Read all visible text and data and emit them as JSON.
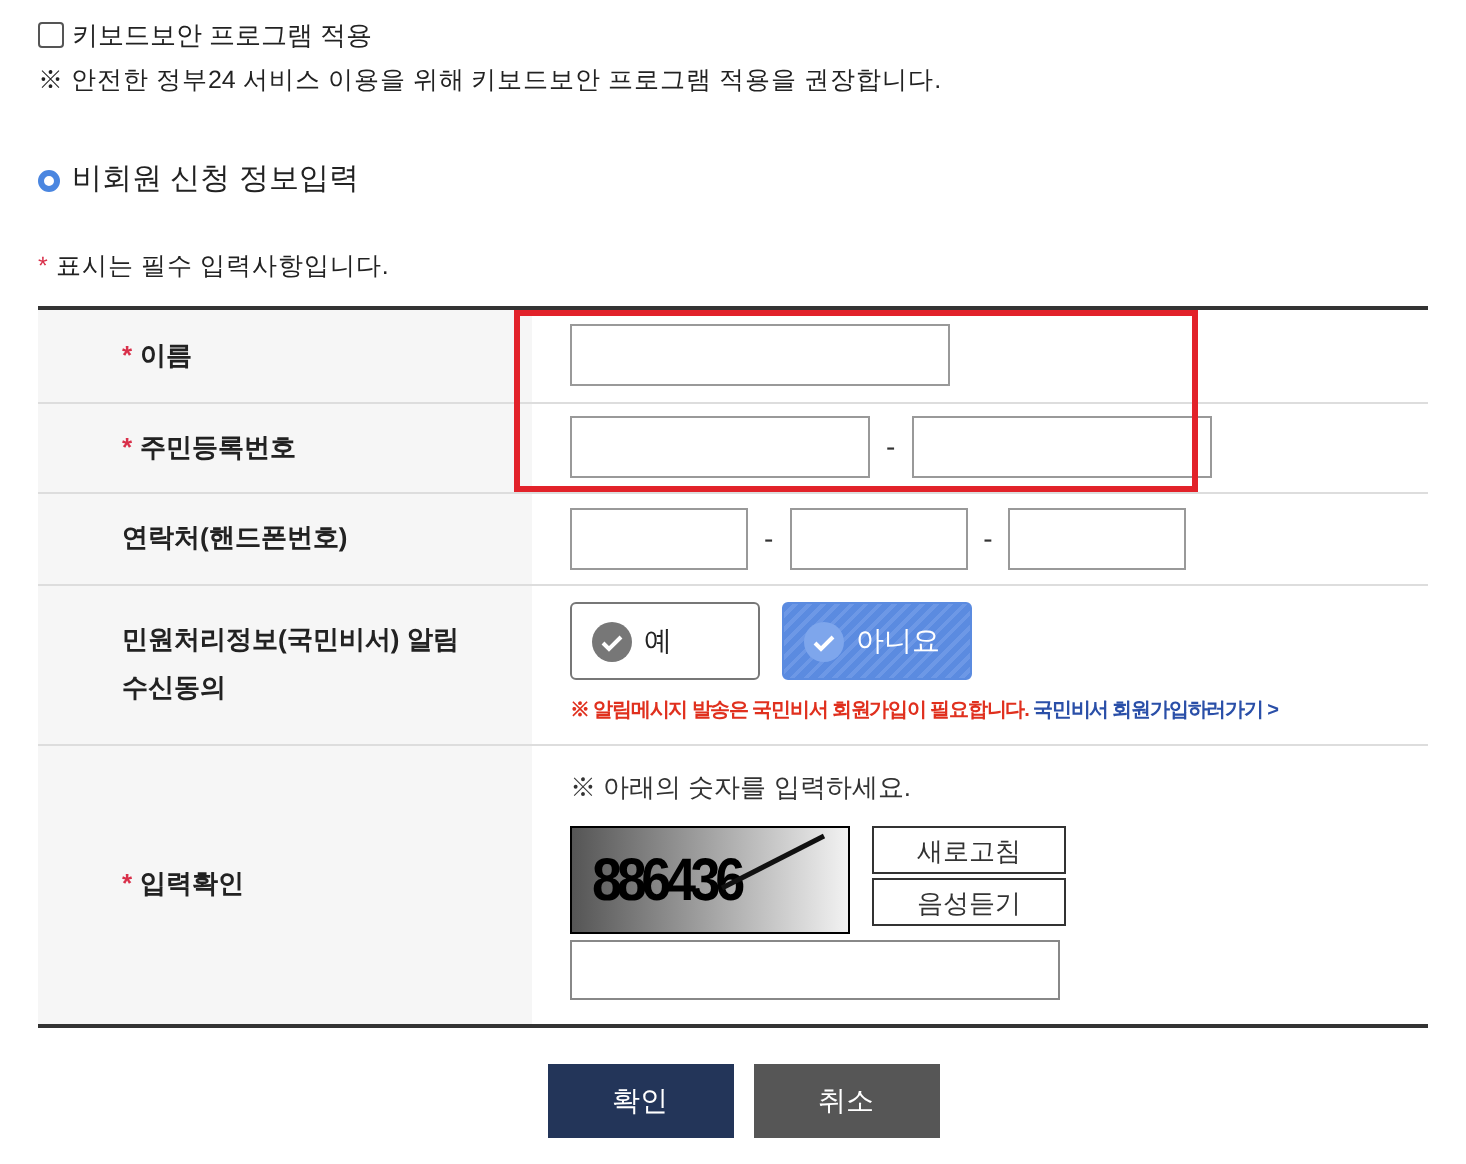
{
  "security": {
    "label": "키보드보안 프로그램 적용",
    "checked": false,
    "note": "※ 안전한 정부24 서비스 이용을 위해 키보드보안 프로그램 적용을 권장합니다."
  },
  "section_title": "비회원 신청 정보입력",
  "required_note": {
    "mark": "*",
    "text": "표시는 필수 입력사항입니다."
  },
  "rows": [
    {
      "kind": "single",
      "label": "이름",
      "required": true
    },
    {
      "kind": "pair",
      "label": "주민등록번호",
      "required": true,
      "separator": "-"
    },
    {
      "kind": "phone",
      "label": "연락처(핸드폰번호)",
      "required": false,
      "separator": "-"
    },
    {
      "kind": "consent",
      "label": "민원처리정보(국민비서) 알림수신동의",
      "required": false,
      "options": [
        {
          "label": "예",
          "selected": false
        },
        {
          "label": "아니요",
          "selected": true
        }
      ],
      "warning": "※  알림메시지 발송은 국민비서 회원가입이 필요합니다.",
      "link": "국민비서 회원가입하러가기 >"
    },
    {
      "kind": "captcha",
      "label": "입력확인",
      "required": true,
      "hint": "※ 아래의 숫자를 입력하세요.",
      "code": "886436",
      "buttons": [
        "새로고침",
        "음성듣기"
      ]
    }
  ],
  "highlight": true,
  "buttons": [
    {
      "label": "확인",
      "kind": "primary"
    },
    {
      "label": "취소",
      "kind": "secondary"
    }
  ]
}
